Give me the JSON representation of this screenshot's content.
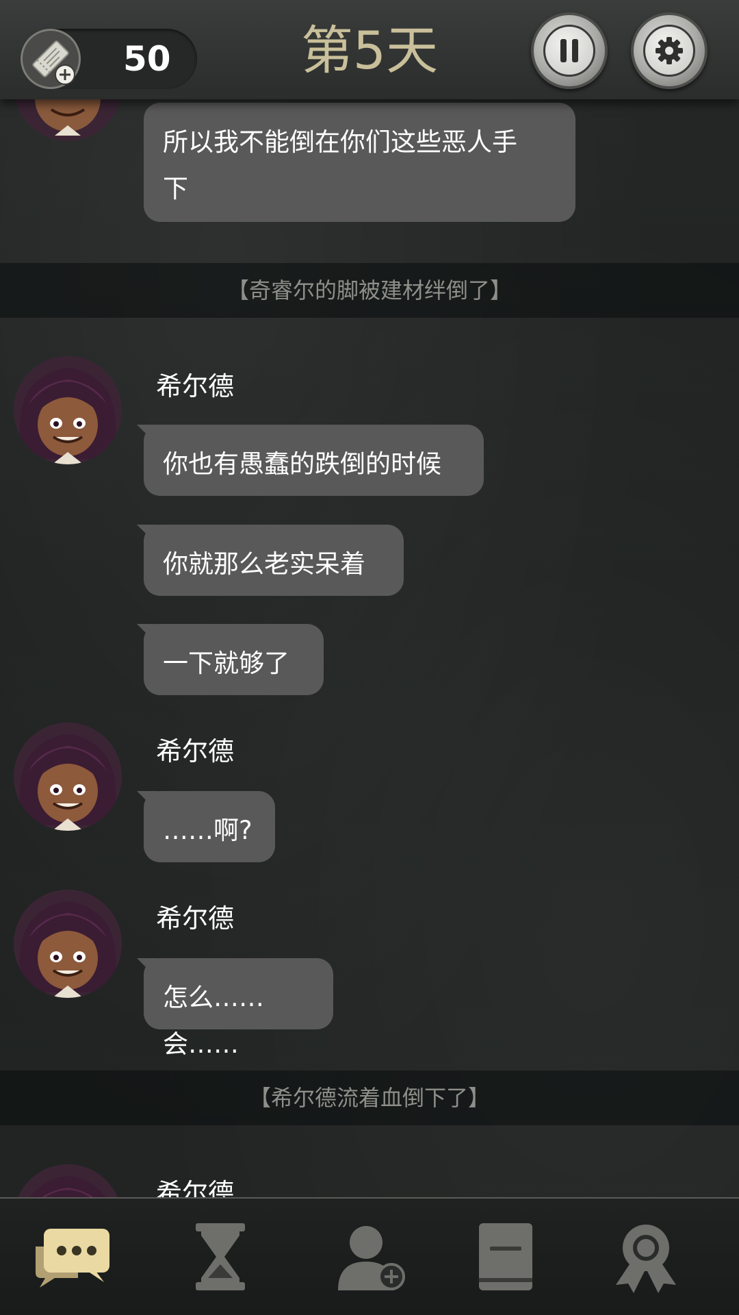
{
  "header": {
    "ticket_count": "50",
    "day_title": "第5天",
    "icons": {
      "ticket": "ticket-add-icon",
      "pause": "pause-icon",
      "settings": "gear-icon"
    }
  },
  "chat": {
    "messages": [
      {
        "type": "bubble",
        "text_line1": "所以我不能倒在你们这些恶人手",
        "text_line2": "下"
      },
      {
        "type": "narration",
        "text": "【奇睿尔的脚被建材绊倒了】"
      },
      {
        "type": "group",
        "speaker": "希尔德",
        "bubbles": [
          "你也有愚蠢的跌倒的时候",
          "你就那么老实呆着",
          "一下就够了"
        ]
      },
      {
        "type": "group",
        "speaker": "希尔德",
        "bubbles": [
          "……啊?"
        ]
      },
      {
        "type": "group",
        "speaker": "希尔德",
        "bubbles": [
          "怎么……会……"
        ]
      },
      {
        "type": "narration",
        "text": "【希尔德流着血倒下了】"
      },
      {
        "type": "group",
        "speaker": "希尔德",
        "bubbles": []
      }
    ]
  },
  "nav": {
    "items": [
      {
        "icon": "chat-bubbles-icon",
        "active": true
      },
      {
        "icon": "hourglass-icon",
        "active": false
      },
      {
        "icon": "add-person-icon",
        "active": false
      },
      {
        "icon": "book-icon",
        "active": false
      },
      {
        "icon": "award-ribbon-icon",
        "active": false
      }
    ],
    "active_color": "#e8d7a0",
    "inactive_color": "#6e6f6a"
  }
}
